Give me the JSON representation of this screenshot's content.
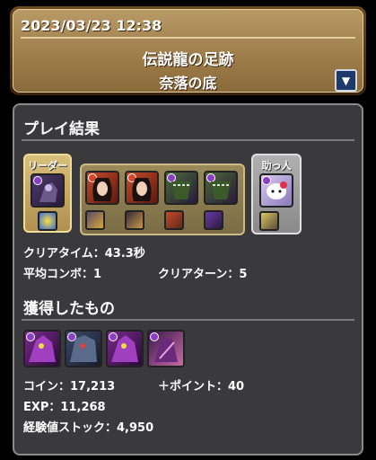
{
  "header": {
    "datetime": "2023/03/23 12:38",
    "dungeon_title": "伝説龍の足跡",
    "floor_name": "奈落の底",
    "toggle_icon": "triangle-down-icon"
  },
  "result": {
    "section_title": "プレイ結果",
    "leader_label": "リーダー",
    "helper_label": "助っ人",
    "clear_time": "クリアタイム：43.3秒",
    "avg_combo": "平均コンボ：1",
    "clear_turns": "クリアターン：5"
  },
  "rewards": {
    "section_title": "獲得したもの",
    "coins": "コイン：17,213",
    "points": "＋ポイント：40",
    "exp": "EXP：11,268",
    "exp_stock": "経験値ストック：4,950"
  },
  "colors": {
    "dark_attr": "#8a3fc4",
    "fire_attr": "#d8452a",
    "banner_gold": "#9c7c48"
  }
}
